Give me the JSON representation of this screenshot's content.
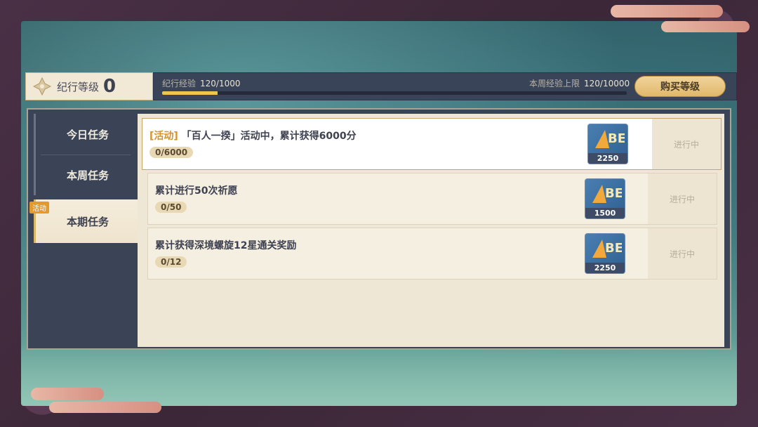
{
  "level": {
    "label": "纪行等级",
    "value": "0"
  },
  "exp": {
    "label": "纪行经验",
    "value": "120/1000",
    "progress": 0.12,
    "weekly_label": "本周经验上限",
    "weekly_value": "120/10000"
  },
  "buy_button": "购买等级",
  "tabs": [
    {
      "label": "今日任务",
      "active": false
    },
    {
      "label": "本周任务",
      "active": false
    },
    {
      "label": "本期任务",
      "active": true,
      "badge": "活动"
    }
  ],
  "tasks": [
    {
      "tag": "[活动]",
      "title": "「百人一揆」活动中，累计获得6000分",
      "progress": "0/6000",
      "reward": "2250",
      "status": "进行中"
    },
    {
      "tag": "",
      "title": "累计进行50次祈愿",
      "progress": "0/50",
      "reward": "1500",
      "status": "进行中"
    },
    {
      "tag": "",
      "title": "累计获得深境螺旋12星通关奖励",
      "progress": "0/12",
      "reward": "2250",
      "status": "进行中"
    }
  ],
  "colors": {
    "accent": "#efc44f",
    "panel": "#3b4457",
    "event_tag": "#d4922a"
  }
}
